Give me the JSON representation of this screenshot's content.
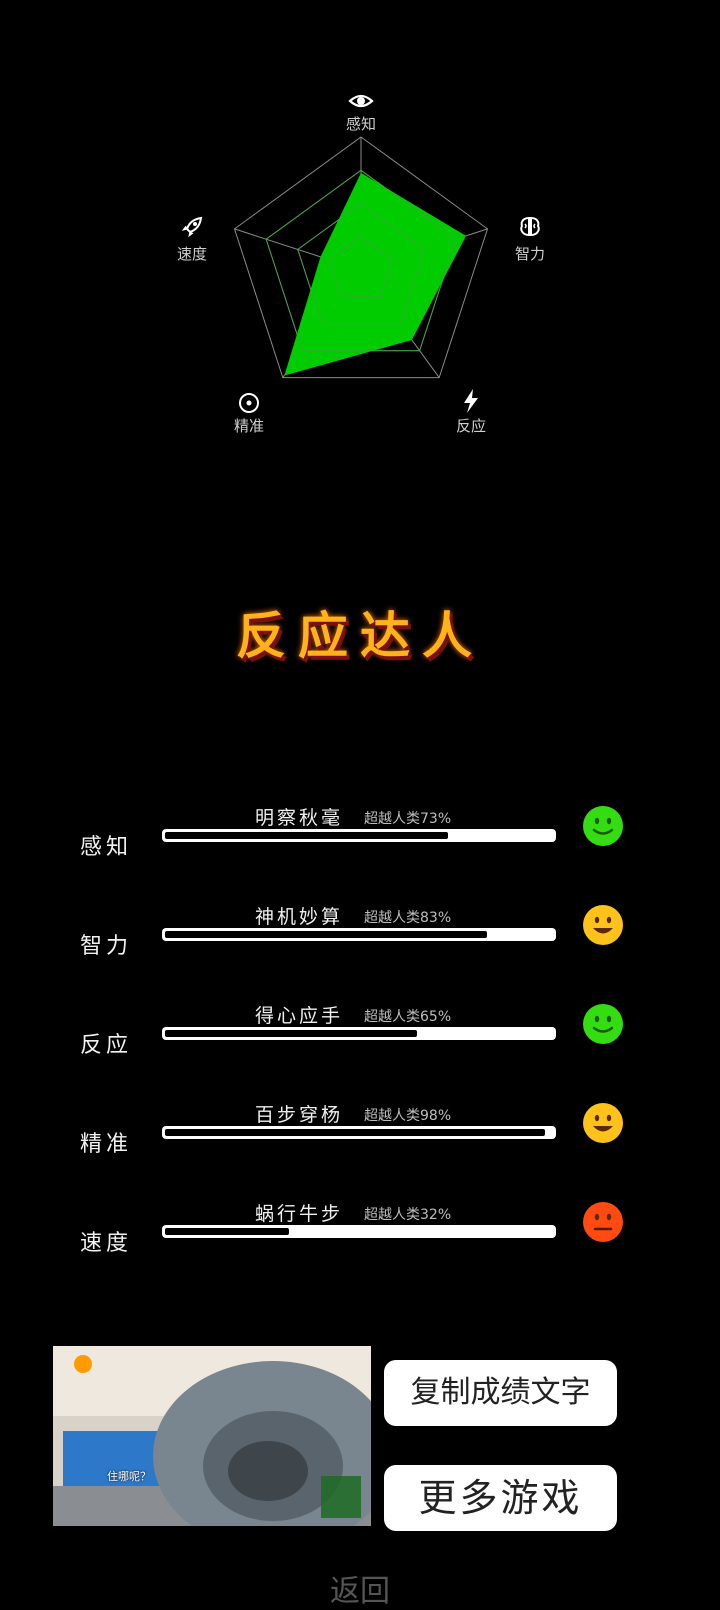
{
  "radar": {
    "axes": [
      {
        "label": "感知",
        "icon": "eye-icon",
        "value": 0.73
      },
      {
        "label": "智力",
        "icon": "brain-icon",
        "value": 0.83
      },
      {
        "label": "反应",
        "icon": "lightning-icon",
        "value": 0.65
      },
      {
        "label": "精准",
        "icon": "target-icon",
        "value": 0.98
      },
      {
        "label": "速度",
        "icon": "rocket-icon",
        "value": 0.32
      }
    ],
    "fill_color": "#00cc00",
    "grid_color": "#8a8a8a"
  },
  "title": "反应达人",
  "stats": [
    {
      "name": "感知",
      "desc": "明察秋毫",
      "pct_text": "超越人类73%",
      "value": 0.73,
      "face": "smile",
      "face_color": "#33dd11"
    },
    {
      "name": "智力",
      "desc": "神机妙算",
      "pct_text": "超越人类83%",
      "value": 0.83,
      "face": "grin",
      "face_color": "#ffc21a"
    },
    {
      "name": "反应",
      "desc": "得心应手",
      "pct_text": "超越人类65%",
      "value": 0.65,
      "face": "smile",
      "face_color": "#33dd11"
    },
    {
      "name": "精准",
      "desc": "百步穿杨",
      "pct_text": "超越人类98%",
      "value": 0.98,
      "face": "grin",
      "face_color": "#ffc21a"
    },
    {
      "name": "速度",
      "desc": "蜗行牛步",
      "pct_text": "超越人类32%",
      "value": 0.32,
      "face": "neutral",
      "face_color": "#ff4a12"
    }
  ],
  "buttons": {
    "copy": "复制成绩文字",
    "more": "更多游戏",
    "back": "返回"
  },
  "ad": {
    "caption": "住哪呢？"
  }
}
